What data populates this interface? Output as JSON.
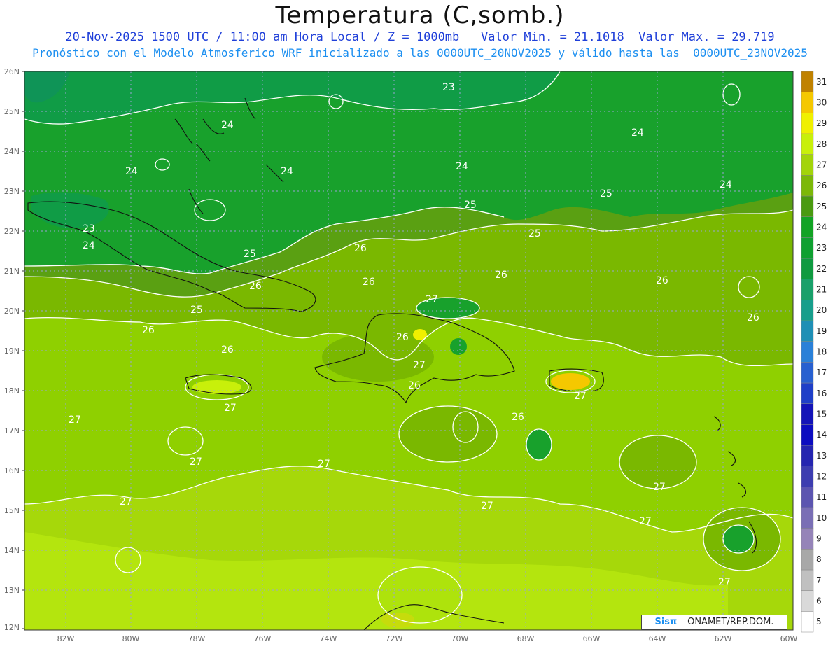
{
  "header": {
    "title": "Temperatura (C,somb.)",
    "line1": "20-Nov-2025 1500 UTC / 11:00 am Hora Local / Z = 1000mb   Valor Min. = 21.1018  Valor Max. = 29.719",
    "line2": "Pronóstico con el Modelo Atmosferico WRF inicializado a las 0000UTC_20NOV2025 y válido hasta las  0000UTC_23NOV2025"
  },
  "axes": {
    "lat_labels": [
      "26N",
      "25N",
      "24N",
      "23N",
      "22N",
      "21N",
      "20N",
      "19N",
      "18N",
      "17N",
      "16N",
      "15N",
      "14N",
      "13N",
      "12N"
    ],
    "lon_labels": [
      "82W",
      "80W",
      "78W",
      "76W",
      "74W",
      "72W",
      "70W",
      "68W",
      "66W",
      "64W",
      "62W",
      "60W"
    ]
  },
  "colorbar": {
    "levels": [
      "5",
      "6",
      "7",
      "8",
      "9",
      "10",
      "11",
      "12",
      "13",
      "14",
      "15",
      "16",
      "17",
      "18",
      "19",
      "20",
      "21",
      "22",
      "23",
      "24",
      "25",
      "26",
      "27",
      "28",
      "29",
      "30",
      "31"
    ],
    "colors": [
      "#ffffff",
      "#d9d9d9",
      "#c0c0c0",
      "#a8a8a8",
      "#9584b8",
      "#7a6fb5",
      "#5c55b0",
      "#3d3db0",
      "#2525b0",
      "#0d0dc0",
      "#1414b8",
      "#1f3fc8",
      "#2860d0",
      "#2a80d8",
      "#1f8fb5",
      "#179e8c",
      "#19a06a",
      "#0f9a40",
      "#0fa030",
      "#12a324",
      "#4a9a10",
      "#7cb808",
      "#a3d40a",
      "#c8f00a",
      "#f0f000",
      "#f5c800",
      "#c08200"
    ]
  },
  "contour_labels": [
    "23",
    "24",
    "24",
    "24",
    "24",
    "24",
    "24",
    "23",
    "24",
    "25",
    "25",
    "25",
    "25",
    "25",
    "26",
    "26",
    "26",
    "26",
    "26",
    "26",
    "26",
    "26",
    "26",
    "26",
    "26",
    "27",
    "27",
    "27",
    "27",
    "27",
    "27",
    "27",
    "27",
    "27",
    "27",
    "27",
    "27"
  ],
  "credit": {
    "sis": "Sisπ",
    "text": "– ONAMET/REP.DOM."
  }
}
